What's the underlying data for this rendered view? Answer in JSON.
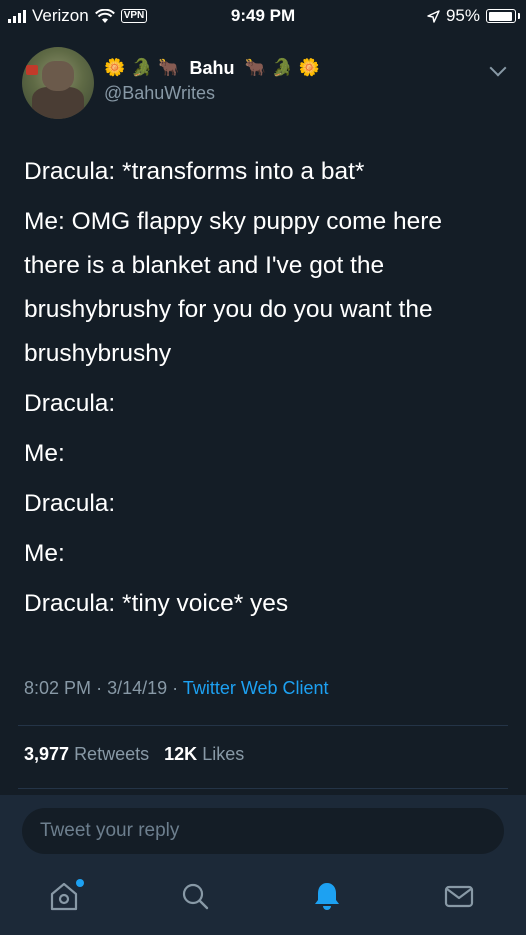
{
  "status": {
    "carrier": "Verizon",
    "vpn": "VPN",
    "time": "9:49 PM",
    "battery_percent": "95%",
    "battery_level": 0.95
  },
  "author": {
    "name": "Bahu",
    "handle": "@BahuWrites",
    "name_emoji_left": [
      "🌼",
      "🐊",
      "🐂"
    ],
    "name_emoji_right": [
      "🐂",
      "🐊",
      "🌼"
    ]
  },
  "tweet": {
    "paragraphs": [
      "Dracula: *transforms into a bat*",
      "Me: OMG flappy sky puppy come here there is a blanket and I've got the brushybrushy for you do you want the brushybrushy",
      "Dracula:",
      "Me:",
      "Dracula:",
      "Me:",
      "Dracula: *tiny voice* yes"
    ],
    "time": "8:02 PM",
    "date": "3/14/19",
    "separator": "·",
    "client": "Twitter Web Client"
  },
  "stats": {
    "retweets_count": "3,977",
    "retweets_label": "Retweets",
    "likes_count": "12K",
    "likes_label": "Likes"
  },
  "reply": {
    "placeholder": "Tweet your reply"
  },
  "tabs": [
    {
      "name": "home",
      "icon": "home-icon"
    },
    {
      "name": "search",
      "icon": "search-icon"
    },
    {
      "name": "notifications",
      "icon": "bell-icon"
    },
    {
      "name": "messages",
      "icon": "mail-icon"
    }
  ],
  "colors": {
    "background": "#141d26",
    "accent": "#1da1f2",
    "secondary_text": "#8899a6"
  }
}
